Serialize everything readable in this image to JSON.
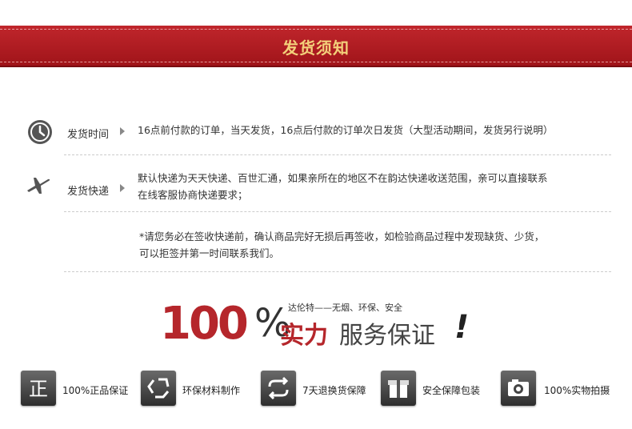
{
  "banner": {
    "title": "发货须知"
  },
  "rows": [
    {
      "label": "发货时间",
      "text": [
        "16点前付款的订单，当天发货，16点后付款的订单次日发货（大型活动期间，发货另行说明）"
      ]
    },
    {
      "label": "发货快递",
      "text": [
        "默认快递为天天快递、百世汇通，如果亲所在的地区不在韵达快递收送范围，亲可以直接联系",
        "在线客服协商快递要求；"
      ]
    }
  ],
  "note": [
    "*请您务必在签收快递前，确认商品完好无损后再签收，如检验商品过程中发现缺货、少货，",
    "可以拒签并第一时间联系我们。"
  ],
  "guarantee": {
    "number": "100",
    "percent": "%",
    "subtitle": "达伦特——无烟、环保、安全",
    "main_red": "实力",
    "main_dark": "服务保证",
    "exclaim": "!"
  },
  "badges": [
    {
      "icon": "zheng-icon",
      "label": "100%正品保证"
    },
    {
      "icon": "recycle-icon",
      "label": "环保材料制作"
    },
    {
      "icon": "exchange-icon",
      "label": "7天退换货保障"
    },
    {
      "icon": "gift-box-icon",
      "label": "安全保障包装"
    },
    {
      "icon": "camera-icon",
      "label": "100%实物拍摄"
    }
  ]
}
